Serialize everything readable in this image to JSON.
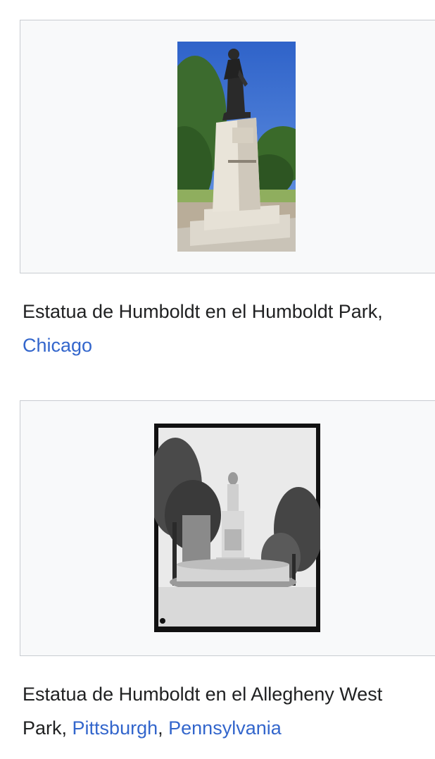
{
  "gallery": [
    {
      "image_alt": "Estatua de Humboldt en el Humboldt Park, Chicago",
      "caption_text": "Estatua de Humboldt en el Humboldt Park,",
      "links": [
        "Chicago"
      ],
      "photo_style": "color"
    },
    {
      "image_alt": "Estatua de Humboldt en el Allegheny West Park, Pittsburgh, Pennsylvania",
      "caption_text": "Estatua de Humboldt en el Allegheny West Park,",
      "links": [
        "Pittsburgh",
        "Pennsylvania"
      ],
      "separator": ", ",
      "photo_style": "black-and-white"
    }
  ],
  "colors": {
    "link": "#3366cc",
    "text": "#202122",
    "box_background": "#f8f9fa",
    "box_border": "#c8ccd1"
  }
}
